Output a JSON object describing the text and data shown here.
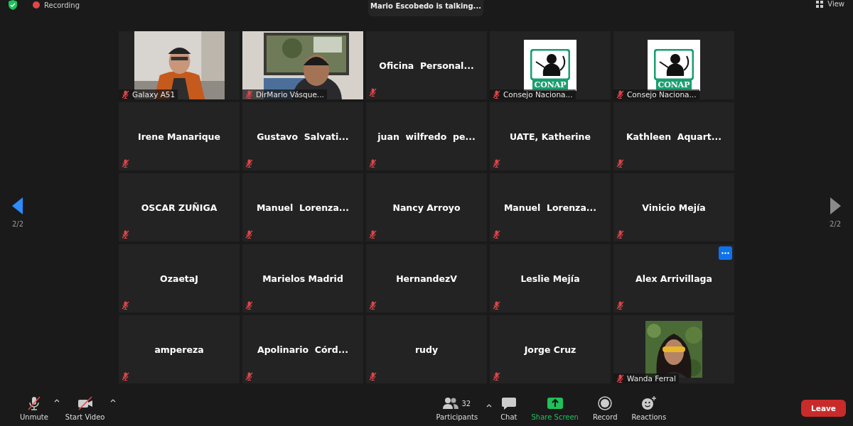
{
  "top_bar": {
    "recording": "Recording",
    "talking": "Mario Escobedo is talking...",
    "view": "View"
  },
  "pager": {
    "previous": {
      "page": "2/2",
      "disabled": false
    },
    "next": {
      "page": "2/2",
      "disabled": true
    }
  },
  "tiles": [
    {
      "kind": "video",
      "letterboxed": true,
      "name": "Galaxy A51",
      "muted": true,
      "more": false
    },
    {
      "kind": "video",
      "letterboxed": false,
      "name": "DirMario Vásque...",
      "muted": true,
      "more": false
    },
    {
      "kind": "name",
      "name": "Oficina  Personal...",
      "muted": true,
      "more": false
    },
    {
      "kind": "logo",
      "logo_text": "CONAP",
      "name": "Consejo Naciona...",
      "muted": true,
      "more": false
    },
    {
      "kind": "logo",
      "logo_text": "CONAP",
      "name": "Consejo Naciona...",
      "muted": true,
      "more": false
    },
    {
      "kind": "name",
      "name": "Irene Manarique",
      "muted": true,
      "more": false
    },
    {
      "kind": "name",
      "name": "Gustavo  Salvati...",
      "muted": true,
      "more": false
    },
    {
      "kind": "name",
      "name": "juan  wilfredo  pe...",
      "muted": true,
      "more": false
    },
    {
      "kind": "name",
      "name": "UATE, Katherine",
      "muted": true,
      "more": false
    },
    {
      "kind": "name",
      "name": "Kathleen  Aquart...",
      "muted": true,
      "more": false
    },
    {
      "kind": "name",
      "name": "OSCAR ZUÑIGA",
      "muted": true,
      "more": false
    },
    {
      "kind": "name",
      "name": "Manuel  Lorenza...",
      "muted": true,
      "more": false
    },
    {
      "kind": "name",
      "name": "Nancy Arroyo",
      "muted": true,
      "more": false
    },
    {
      "kind": "name",
      "name": "Manuel  Lorenza...",
      "muted": true,
      "more": false
    },
    {
      "kind": "name",
      "name": "Vinicio Mejía",
      "muted": true,
      "more": false
    },
    {
      "kind": "name",
      "name": "OzaetaJ",
      "muted": true,
      "more": false
    },
    {
      "kind": "name",
      "name": "Marielos Madrid",
      "muted": true,
      "more": false
    },
    {
      "kind": "name",
      "name": "HernandezV",
      "muted": true,
      "more": false
    },
    {
      "kind": "name",
      "name": "Leslie Mejía",
      "muted": true,
      "more": false
    },
    {
      "kind": "name",
      "name": "Alex Arrivillaga",
      "muted": true,
      "more": true
    },
    {
      "kind": "name",
      "name": "ampereza",
      "muted": true,
      "more": false
    },
    {
      "kind": "name",
      "name": "Apolinario  Córd...",
      "muted": true,
      "more": false
    },
    {
      "kind": "name",
      "name": "rudy",
      "muted": true,
      "more": false
    },
    {
      "kind": "name",
      "name": "Jorge Cruz",
      "muted": true,
      "more": false
    },
    {
      "name": "Wanda Ferral",
      "muted": true,
      "more": false
    }
  ],
  "toolbar": {
    "left": [
      {
        "kind": "mic",
        "label": "Unmute",
        "off": true
      },
      {
        "kind": "camera",
        "label": "Start Video",
        "off": true
      }
    ],
    "center": [
      {
        "kind": "participants",
        "label": "Participants",
        "count": "32"
      },
      {
        "kind": "chat",
        "label": "Chat"
      },
      {
        "kind": "share",
        "label": "Share Screen"
      },
      {
        "kind": "record",
        "label": "Record"
      },
      {
        "kind": "reactions",
        "label": "Reactions"
      }
    ],
    "leave": "Leave"
  }
}
